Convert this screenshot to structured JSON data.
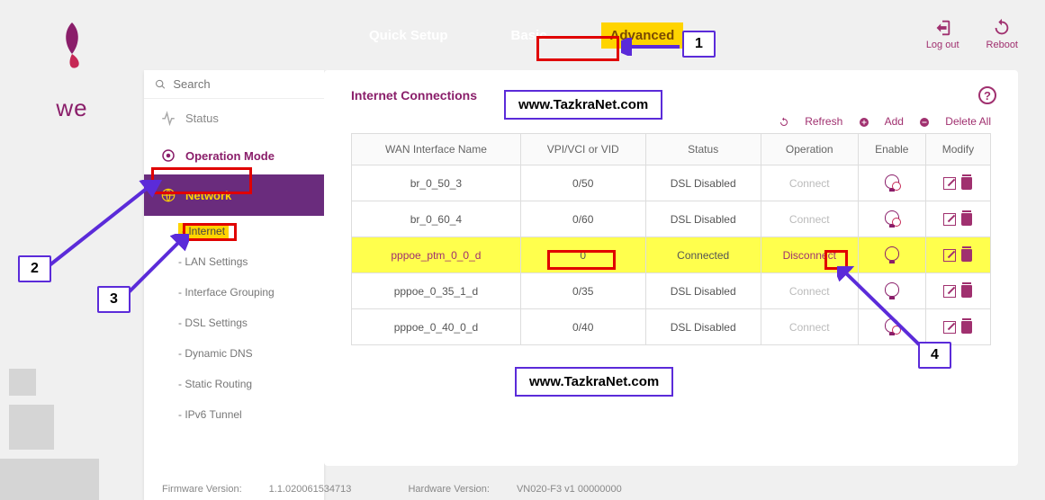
{
  "brand": "we",
  "search": {
    "placeholder": "Search"
  },
  "sidebar": {
    "status": "Status",
    "op_mode": "Operation Mode",
    "network": "Network",
    "sub": {
      "internet": "- Internet",
      "lan": "- LAN Settings",
      "ifgroup": "- Interface Grouping",
      "dsl": "- DSL Settings",
      "ddns": "- Dynamic DNS",
      "routing": "- Static Routing",
      "ipv6": "- IPv6 Tunnel"
    }
  },
  "tabs": {
    "quick": "Quick Setup",
    "basic": "Basic",
    "advanced": "Advanced"
  },
  "top_right": {
    "logout": "Log out",
    "reboot": "Reboot"
  },
  "panel": {
    "title": "Internet Connections",
    "actions": {
      "refresh": "Refresh",
      "add": "Add",
      "delete_all": "Delete All"
    },
    "headers": {
      "name": "WAN Interface Name",
      "vpi": "VPI/VCI or VID",
      "status": "Status",
      "operation": "Operation",
      "enable": "Enable",
      "modify": "Modify"
    },
    "rows": [
      {
        "name": "br_0_50_3",
        "vpi": "0/50",
        "status": "DSL Disabled",
        "op": "Connect",
        "enabled": false,
        "disc": false
      },
      {
        "name": "br_0_60_4",
        "vpi": "0/60",
        "status": "DSL Disabled",
        "op": "Connect",
        "enabled": false,
        "disc": false
      },
      {
        "name": "pppoe_ptm_0_0_d",
        "vpi": "0",
        "status": "Connected",
        "op": "Disconnect",
        "enabled": true,
        "disc": true,
        "hl": true
      },
      {
        "name": "pppoe_0_35_1_d",
        "vpi": "0/35",
        "status": "DSL Disabled",
        "op": "Connect",
        "enabled": true,
        "disc": false
      },
      {
        "name": "pppoe_0_40_0_d",
        "vpi": "0/40",
        "status": "DSL Disabled",
        "op": "Connect",
        "enabled": false,
        "disc": false
      }
    ]
  },
  "footer": {
    "fw_label": "Firmware Version:",
    "fw": "1.1.020061534713",
    "hw_label": "Hardware Version:",
    "hw": "VN020-F3 v1 00000000"
  },
  "watermark": "www.TazkraNet.com",
  "callouts": {
    "c1": "1",
    "c2": "2",
    "c3": "3",
    "c4": "4"
  }
}
